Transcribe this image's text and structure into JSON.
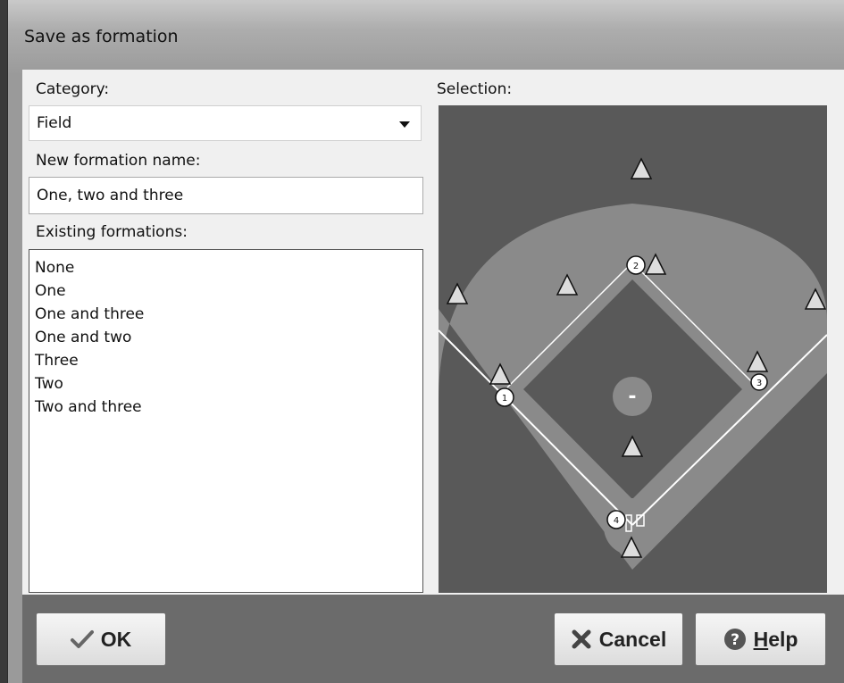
{
  "window": {
    "title": "Save as formation"
  },
  "category": {
    "label": "Category:",
    "value": "Field"
  },
  "name": {
    "label": "New formation name:",
    "value": "One, two and three"
  },
  "existing": {
    "label": "Existing formations:",
    "items": [
      "None",
      "One",
      "One and three",
      "One and two",
      "Three",
      "Two",
      "Two and three"
    ]
  },
  "selection": {
    "label": "Selection:"
  },
  "field_markers": {
    "runners": [
      "2",
      "1",
      "3",
      "4"
    ],
    "mound_label": "-"
  },
  "buttons": {
    "ok": "OK",
    "cancel": "Cancel",
    "help_mnemonic": "H",
    "help_rest": "elp"
  },
  "icons": {
    "ok": "checkmark-icon",
    "cancel": "cancel-x-icon",
    "help": "help-question-icon",
    "dropdown": "chevron-down-icon"
  }
}
